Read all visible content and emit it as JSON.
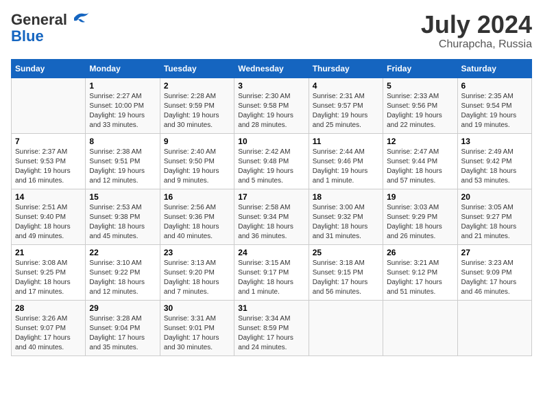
{
  "header": {
    "logo_general": "General",
    "logo_blue": "Blue",
    "month": "July 2024",
    "location": "Churapcha, Russia"
  },
  "columns": [
    "Sunday",
    "Monday",
    "Tuesday",
    "Wednesday",
    "Thursday",
    "Friday",
    "Saturday"
  ],
  "rows": [
    [
      {
        "day": "",
        "info": ""
      },
      {
        "day": "1",
        "info": "Sunrise: 2:27 AM\nSunset: 10:00 PM\nDaylight: 19 hours\nand 33 minutes."
      },
      {
        "day": "2",
        "info": "Sunrise: 2:28 AM\nSunset: 9:59 PM\nDaylight: 19 hours\nand 30 minutes."
      },
      {
        "day": "3",
        "info": "Sunrise: 2:30 AM\nSunset: 9:58 PM\nDaylight: 19 hours\nand 28 minutes."
      },
      {
        "day": "4",
        "info": "Sunrise: 2:31 AM\nSunset: 9:57 PM\nDaylight: 19 hours\nand 25 minutes."
      },
      {
        "day": "5",
        "info": "Sunrise: 2:33 AM\nSunset: 9:56 PM\nDaylight: 19 hours\nand 22 minutes."
      },
      {
        "day": "6",
        "info": "Sunrise: 2:35 AM\nSunset: 9:54 PM\nDaylight: 19 hours\nand 19 minutes."
      }
    ],
    [
      {
        "day": "7",
        "info": "Sunrise: 2:37 AM\nSunset: 9:53 PM\nDaylight: 19 hours\nand 16 minutes."
      },
      {
        "day": "8",
        "info": "Sunrise: 2:38 AM\nSunset: 9:51 PM\nDaylight: 19 hours\nand 12 minutes."
      },
      {
        "day": "9",
        "info": "Sunrise: 2:40 AM\nSunset: 9:50 PM\nDaylight: 19 hours\nand 9 minutes."
      },
      {
        "day": "10",
        "info": "Sunrise: 2:42 AM\nSunset: 9:48 PM\nDaylight: 19 hours\nand 5 minutes."
      },
      {
        "day": "11",
        "info": "Sunrise: 2:44 AM\nSunset: 9:46 PM\nDaylight: 19 hours\nand 1 minute."
      },
      {
        "day": "12",
        "info": "Sunrise: 2:47 AM\nSunset: 9:44 PM\nDaylight: 18 hours\nand 57 minutes."
      },
      {
        "day": "13",
        "info": "Sunrise: 2:49 AM\nSunset: 9:42 PM\nDaylight: 18 hours\nand 53 minutes."
      }
    ],
    [
      {
        "day": "14",
        "info": "Sunrise: 2:51 AM\nSunset: 9:40 PM\nDaylight: 18 hours\nand 49 minutes."
      },
      {
        "day": "15",
        "info": "Sunrise: 2:53 AM\nSunset: 9:38 PM\nDaylight: 18 hours\nand 45 minutes."
      },
      {
        "day": "16",
        "info": "Sunrise: 2:56 AM\nSunset: 9:36 PM\nDaylight: 18 hours\nand 40 minutes."
      },
      {
        "day": "17",
        "info": "Sunrise: 2:58 AM\nSunset: 9:34 PM\nDaylight: 18 hours\nand 36 minutes."
      },
      {
        "day": "18",
        "info": "Sunrise: 3:00 AM\nSunset: 9:32 PM\nDaylight: 18 hours\nand 31 minutes."
      },
      {
        "day": "19",
        "info": "Sunrise: 3:03 AM\nSunset: 9:29 PM\nDaylight: 18 hours\nand 26 minutes."
      },
      {
        "day": "20",
        "info": "Sunrise: 3:05 AM\nSunset: 9:27 PM\nDaylight: 18 hours\nand 21 minutes."
      }
    ],
    [
      {
        "day": "21",
        "info": "Sunrise: 3:08 AM\nSunset: 9:25 PM\nDaylight: 18 hours\nand 17 minutes."
      },
      {
        "day": "22",
        "info": "Sunrise: 3:10 AM\nSunset: 9:22 PM\nDaylight: 18 hours\nand 12 minutes."
      },
      {
        "day": "23",
        "info": "Sunrise: 3:13 AM\nSunset: 9:20 PM\nDaylight: 18 hours\nand 7 minutes."
      },
      {
        "day": "24",
        "info": "Sunrise: 3:15 AM\nSunset: 9:17 PM\nDaylight: 18 hours\nand 1 minute."
      },
      {
        "day": "25",
        "info": "Sunrise: 3:18 AM\nSunset: 9:15 PM\nDaylight: 17 hours\nand 56 minutes."
      },
      {
        "day": "26",
        "info": "Sunrise: 3:21 AM\nSunset: 9:12 PM\nDaylight: 17 hours\nand 51 minutes."
      },
      {
        "day": "27",
        "info": "Sunrise: 3:23 AM\nSunset: 9:09 PM\nDaylight: 17 hours\nand 46 minutes."
      }
    ],
    [
      {
        "day": "28",
        "info": "Sunrise: 3:26 AM\nSunset: 9:07 PM\nDaylight: 17 hours\nand 40 minutes."
      },
      {
        "day": "29",
        "info": "Sunrise: 3:28 AM\nSunset: 9:04 PM\nDaylight: 17 hours\nand 35 minutes."
      },
      {
        "day": "30",
        "info": "Sunrise: 3:31 AM\nSunset: 9:01 PM\nDaylight: 17 hours\nand 30 minutes."
      },
      {
        "day": "31",
        "info": "Sunrise: 3:34 AM\nSunset: 8:59 PM\nDaylight: 17 hours\nand 24 minutes."
      },
      {
        "day": "",
        "info": ""
      },
      {
        "day": "",
        "info": ""
      },
      {
        "day": "",
        "info": ""
      }
    ]
  ]
}
